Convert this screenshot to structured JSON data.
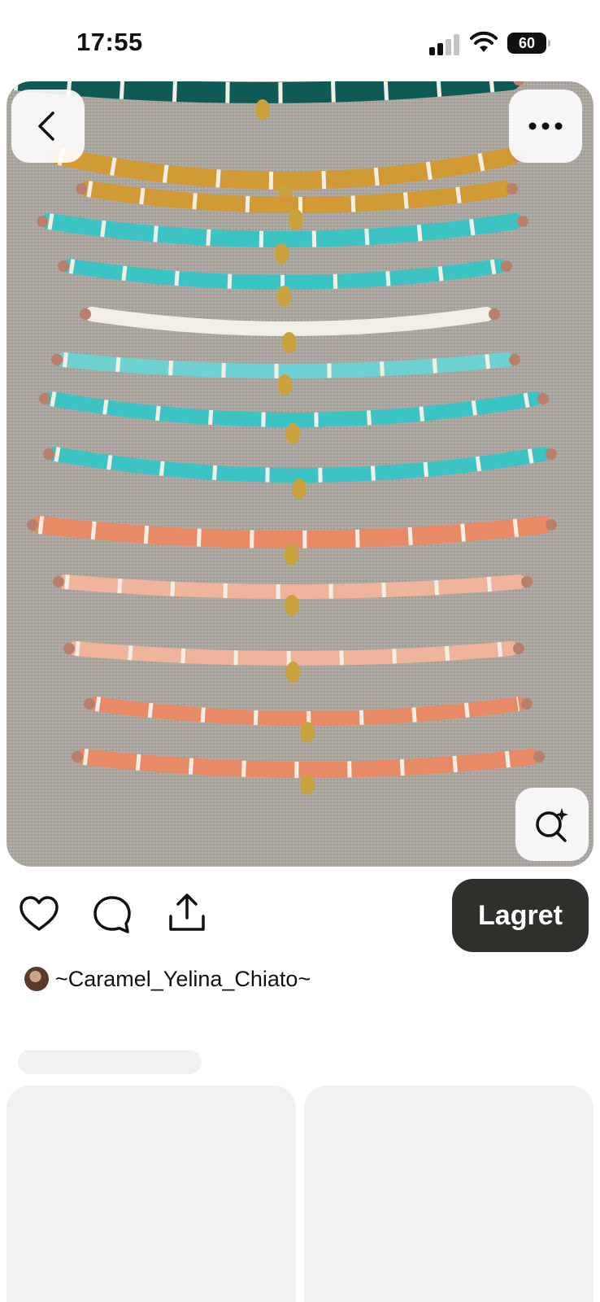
{
  "status_bar": {
    "time": "17:55",
    "battery": "60",
    "icons": [
      "cellular-signal-icon",
      "wifi-icon",
      "battery-icon"
    ]
  },
  "pin": {
    "image_description": "bracelets",
    "colors": {
      "teal_dark": "#0f5a57",
      "mustard": "#d19a35",
      "turquoise": "#3cc3c4",
      "aqua": "#6fd2d2",
      "white_bead": "#f1efe7",
      "coral": "#e98a67",
      "peach": "#f0b39c",
      "gold": "#c9a23d",
      "linen": "#aca6a0"
    }
  },
  "overlay": {
    "back_icon": "chevron-left-icon",
    "more_icon": "more-horizontal-icon",
    "visual_search_icon": "visual-search-icon"
  },
  "actions": {
    "like_icon": "heart-icon",
    "comment_icon": "comment-icon",
    "share_icon": "share-icon",
    "saved_label": "Lagret"
  },
  "creator": {
    "name": "~Caramel_Yelina_Chiato~"
  },
  "theme": {
    "saved_button_bg": "#2f2f2c",
    "skeleton": "#f1f1ef"
  }
}
